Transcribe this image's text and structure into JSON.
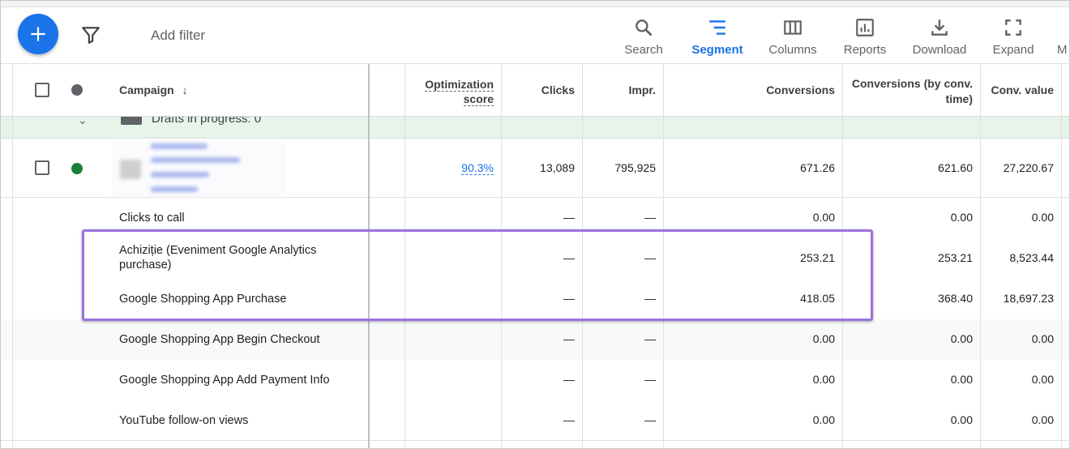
{
  "toolbar": {
    "add_filter": "Add filter",
    "tools": [
      {
        "label": "Search",
        "icon": "search-icon"
      },
      {
        "label": "Segment",
        "icon": "segment-icon"
      },
      {
        "label": "Columns",
        "icon": "columns-icon"
      },
      {
        "label": "Reports",
        "icon": "reports-icon"
      },
      {
        "label": "Download",
        "icon": "download-icon"
      },
      {
        "label": "Expand",
        "icon": "expand-icon"
      },
      {
        "label": "M",
        "icon": "more-icon"
      }
    ],
    "active_tool": "Segment"
  },
  "colors": {
    "accent": "#1a73e8",
    "status_enabled": "#188038",
    "highlight": "#9b72e0",
    "drafts_bg": "#e6f4ea"
  },
  "table": {
    "headers": {
      "campaign": "Campaign",
      "opt_score_1": "Optimization",
      "opt_score_2": "score",
      "clicks": "Clicks",
      "impr": "Impr.",
      "conversions": "Conversions",
      "conv_by_time_1": "Conversions (by conv.",
      "conv_by_time_2": "time)",
      "conv_value": "Conv. value"
    },
    "drafts": "Drafts in progress: 0",
    "campaign_row": {
      "opt_score": "90.3%",
      "clicks": "13,089",
      "impr": "795,925",
      "conversions": "671.26",
      "conv_by_time": "621.60",
      "conv_value": "27,220.67"
    },
    "segment_rows": [
      {
        "name": "Clicks to call",
        "clicks": "—",
        "impr": "—",
        "conversions": "0.00",
        "conv_by_time": "0.00",
        "conv_value": "0.00"
      },
      {
        "name": "Achiziție (Eveniment Google Analytics purchase)",
        "clicks": "—",
        "impr": "—",
        "conversions": "253.21",
        "conv_by_time": "253.21",
        "conv_value": "8,523.44"
      },
      {
        "name": "Google Shopping App Purchase",
        "clicks": "—",
        "impr": "—",
        "conversions": "418.05",
        "conv_by_time": "368.40",
        "conv_value": "18,697.23"
      },
      {
        "name": "Google Shopping App Begin Checkout",
        "clicks": "—",
        "impr": "—",
        "conversions": "0.00",
        "conv_by_time": "0.00",
        "conv_value": "0.00"
      },
      {
        "name": "Google Shopping App Add Payment Info",
        "clicks": "—",
        "impr": "—",
        "conversions": "0.00",
        "conv_by_time": "0.00",
        "conv_value": "0.00"
      },
      {
        "name": "YouTube follow-on views",
        "clicks": "—",
        "impr": "—",
        "conversions": "0.00",
        "conv_by_time": "0.00",
        "conv_value": "0.00"
      }
    ]
  }
}
